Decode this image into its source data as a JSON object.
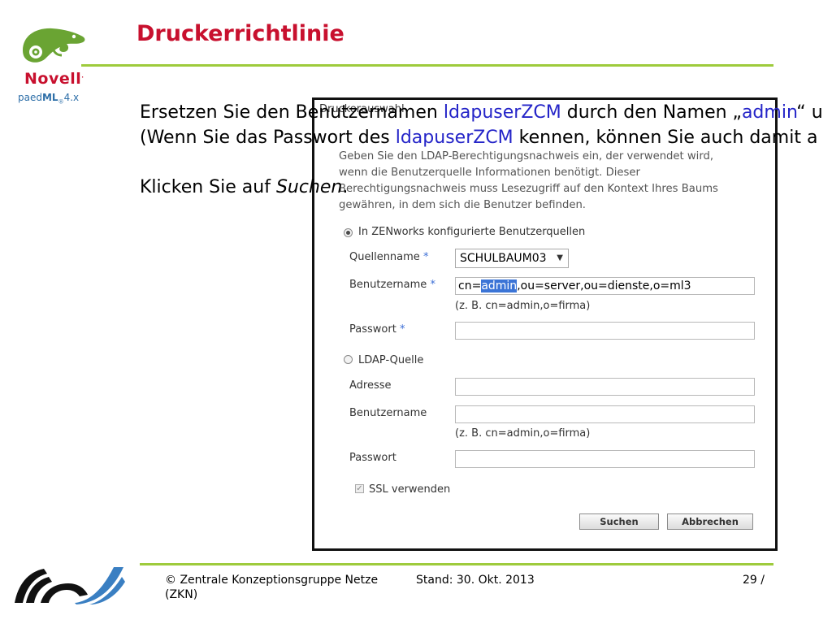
{
  "colors": {
    "brand_red": "#c8102e",
    "accent_green": "#9ecb3c",
    "link_blue": "#2424c8",
    "selection_blue": "#3b74d6"
  },
  "logo": {
    "brand": "Novell",
    "product_prefix": "paed",
    "product_bold": "ML",
    "product_reg": "®",
    "product_version": "4.x"
  },
  "slide": {
    "title": "Druckerrichtlinie",
    "line1": {
      "a": "Ersetzen Sie den Benutzernamen ",
      "b": "ldapuserZCM",
      "c": " durch den Namen „",
      "d": "admin",
      "e": "“ u"
    },
    "line2": {
      "a": "(Wenn Sie das Passwort des ",
      "b": "ldapuserZCM",
      "c": " kennen, können Sie auch damit a"
    },
    "line3": {
      "a": "Klicken Sie auf ",
      "b": "Suchen",
      "c": "."
    }
  },
  "dialog": {
    "title": "Druckerauswahl",
    "intro": "Geben Sie den LDAP-Berechtigungsnachweis ein, der verwendet wird, wenn die Benutzerquelle Informationen benötigt. Dieser Berechtigungsnachweis muss Lesezugriff auf den Kontext Ihres Baums gewähren, in dem sich die Benutzer befinden.",
    "option1": {
      "label": "In ZENworks konfigurierte Benutzerquellen",
      "selected": true,
      "source_label": "Quellenname",
      "source_value": "SCHULBAUM03",
      "user_label": "Benutzername",
      "user_prefix": "cn=",
      "user_selected": "admin",
      "user_suffix": ",ou=server,ou=dienste,o=ml3",
      "user_hint": "(z. B. cn=admin,o=firma)",
      "password_label": "Passwort",
      "password_value": ""
    },
    "option2": {
      "label": "LDAP-Quelle",
      "selected": false,
      "address_label": "Adresse",
      "address_value": "",
      "user_label": "Benutzername",
      "user_value": "",
      "user_hint": "(z. B. cn=admin,o=firma)",
      "password_label": "Passwort",
      "password_value": "",
      "ssl_label": "SSL verwenden",
      "ssl_checked": true
    },
    "required_mark": "*",
    "search_button": "Suchen",
    "cancel_button": "Abbrechen"
  },
  "footer": {
    "org_line1": "© Zentrale Konzeptionsgruppe Netze",
    "org_line2": "(ZKN)",
    "date": "Stand: 30. Okt. 2013",
    "page": "29 /"
  }
}
